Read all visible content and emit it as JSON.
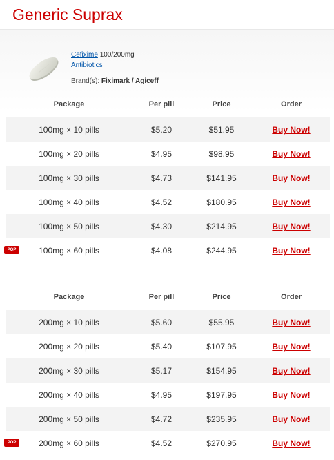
{
  "page": {
    "title": "Generic Suprax"
  },
  "product": {
    "name_link": "Cefixime",
    "dosage": "100/200mg",
    "category_link": "Antibiotics",
    "brands_label": "Brand(s):",
    "brands_value": "Fiximark / Agiceff",
    "image_icon": "pill-icon"
  },
  "tables": [
    {
      "headers": {
        "package": "Package",
        "per_pill": "Per pill",
        "price": "Price",
        "order": "Order"
      },
      "rows": [
        {
          "package": "100mg × 10 pills",
          "per_pill": "$5.20",
          "price": "$51.95",
          "order": "Buy Now!",
          "badge": ""
        },
        {
          "package": "100mg × 20 pills",
          "per_pill": "$4.95",
          "price": "$98.95",
          "order": "Buy Now!",
          "badge": ""
        },
        {
          "package": "100mg × 30 pills",
          "per_pill": "$4.73",
          "price": "$141.95",
          "order": "Buy Now!",
          "badge": ""
        },
        {
          "package": "100mg × 40 pills",
          "per_pill": "$4.52",
          "price": "$180.95",
          "order": "Buy Now!",
          "badge": ""
        },
        {
          "package": "100mg × 50 pills",
          "per_pill": "$4.30",
          "price": "$214.95",
          "order": "Buy Now!",
          "badge": ""
        },
        {
          "package": "100mg × 60 pills",
          "per_pill": "$4.08",
          "price": "$244.95",
          "order": "Buy Now!",
          "badge": "POP"
        }
      ]
    },
    {
      "headers": {
        "package": "Package",
        "per_pill": "Per pill",
        "price": "Price",
        "order": "Order"
      },
      "rows": [
        {
          "package": "200mg × 10 pills",
          "per_pill": "$5.60",
          "price": "$55.95",
          "order": "Buy Now!",
          "badge": ""
        },
        {
          "package": "200mg × 20 pills",
          "per_pill": "$5.40",
          "price": "$107.95",
          "order": "Buy Now!",
          "badge": ""
        },
        {
          "package": "200mg × 30 pills",
          "per_pill": "$5.17",
          "price": "$154.95",
          "order": "Buy Now!",
          "badge": ""
        },
        {
          "package": "200mg × 40 pills",
          "per_pill": "$4.95",
          "price": "$197.95",
          "order": "Buy Now!",
          "badge": ""
        },
        {
          "package": "200mg × 50 pills",
          "per_pill": "$4.72",
          "price": "$235.95",
          "order": "Buy Now!",
          "badge": ""
        },
        {
          "package": "200mg × 60 pills",
          "per_pill": "$4.52",
          "price": "$270.95",
          "order": "Buy Now!",
          "badge": "POP"
        }
      ]
    }
  ]
}
